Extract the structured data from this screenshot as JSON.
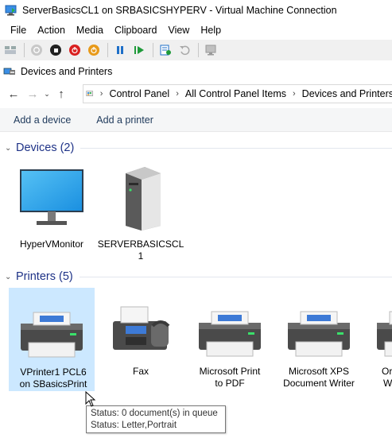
{
  "titlebar": {
    "title": "ServerBasicsCL1 on SRBASICSHYPERV - Virtual Machine Connection",
    "icon": "vm-monitor-icon"
  },
  "menubar": {
    "items": [
      "File",
      "Action",
      "Media",
      "Clipboard",
      "View",
      "Help"
    ]
  },
  "vm_toolbar": {
    "icons": [
      "ctrl-alt-del-icon",
      "start-icon",
      "turn-off-icon",
      "shutdown-icon",
      "power-icon",
      "pause-icon",
      "resume-icon",
      "checkpoint-icon",
      "revert-icon",
      "enhanced-session-icon"
    ]
  },
  "window": {
    "title": "Devices and Printers"
  },
  "address": {
    "crumbs": [
      "Control Panel",
      "All Control Panel Items",
      "Devices and Printers"
    ]
  },
  "commands": {
    "add_device": "Add a device",
    "add_printer": "Add a printer"
  },
  "groups": {
    "devices": {
      "title": "Devices (2)",
      "items": [
        {
          "line1": "HyperVMonitor",
          "line2": ""
        },
        {
          "line1": "SERVERBASICSCL",
          "line2": "1"
        }
      ]
    },
    "printers": {
      "title": "Printers (5)",
      "items": [
        {
          "line1": "VPrinter1 PCL6",
          "line2": "on SBasicsPrint"
        },
        {
          "line1": "Fax",
          "line2": ""
        },
        {
          "line1": "Microsoft Print",
          "line2": "to PDF"
        },
        {
          "line1": "Microsoft XPS",
          "line2": "Document Writer"
        },
        {
          "line1": "Or",
          "line2": "W"
        }
      ]
    }
  },
  "tooltip": {
    "line1": "Status: 0 document(s) in queue",
    "line2": "Status: Letter,Portrait"
  },
  "colors": {
    "group_title": "#1e3287",
    "selection": "#cce8ff",
    "command_text": "#1e395b"
  }
}
